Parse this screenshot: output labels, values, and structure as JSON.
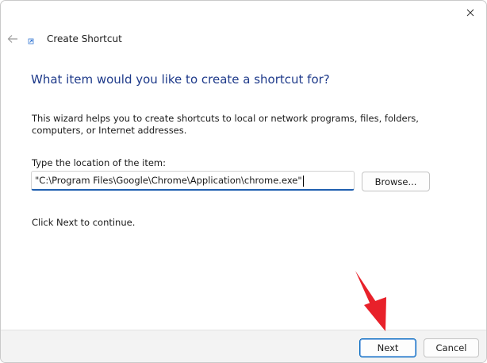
{
  "window": {
    "title": "Create Shortcut"
  },
  "page": {
    "heading": "What item would you like to create a shortcut for?",
    "description": "This wizard helps you to create shortcuts to local or network programs, files, folders, computers, or Internet addresses.",
    "location_label": "Type the location of the item:",
    "location_value": "\"C:\\Program Files\\Google\\Chrome\\Application\\chrome.exe\"",
    "browse_label": "Browse...",
    "continue_text": "Click Next to continue."
  },
  "footer": {
    "next_label": "Next",
    "cancel_label": "Cancel"
  },
  "icons": {
    "close": "close-icon",
    "back": "back-arrow-icon",
    "wizard": "shortcut-icon"
  },
  "colors": {
    "heading": "#1e3a8a",
    "accent": "#0067c0",
    "annotation_arrow": "#e8212a"
  }
}
